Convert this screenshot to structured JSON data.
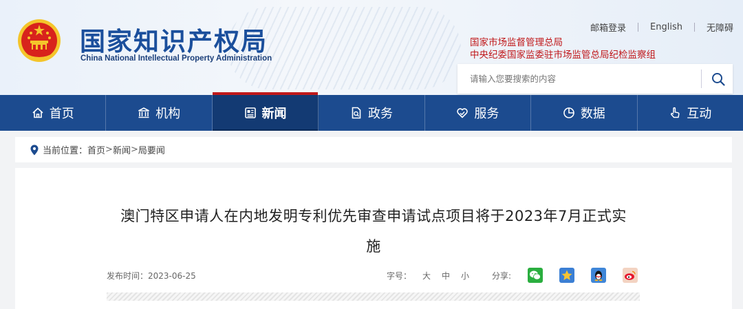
{
  "header": {
    "logo_cn": "国家知识产权局",
    "logo_en": "China National Intellectual Property Administration",
    "top_links": [
      "邮箱登录",
      "English",
      "无障碍"
    ],
    "agencies": [
      "国家市场监督管理总局",
      "中央纪委国家监委驻市场监管总局纪检监察组"
    ],
    "search_placeholder": "请输入您要搜索的内容"
  },
  "nav": {
    "items": [
      {
        "label": "首页",
        "icon": "home-icon"
      },
      {
        "label": "机构",
        "icon": "institution-icon"
      },
      {
        "label": "新闻",
        "icon": "news-icon",
        "active": true
      },
      {
        "label": "政务",
        "icon": "document-icon"
      },
      {
        "label": "服务",
        "icon": "service-heart-icon"
      },
      {
        "label": "数据",
        "icon": "pie-chart-icon"
      },
      {
        "label": "互动",
        "icon": "hand-pointer-icon"
      }
    ]
  },
  "breadcrumb": {
    "prefix": "当前位置：",
    "items": [
      "首页",
      "新闻",
      "局要闻"
    ],
    "separator": ">"
  },
  "article": {
    "title_line1": "澳门特区申请人在内地发明专利优先审查申请试点项目将于2023年7月正式实",
    "title_line2": "施",
    "publish_label": "发布时间：",
    "publish_date": "2023-06-25",
    "fontsize_label": "字号：",
    "fontsizes": [
      "大",
      "中",
      "小"
    ],
    "share_label": "分享:",
    "share_icons": [
      "wechat-icon",
      "qzone-star-icon",
      "qq-penguin-icon",
      "weibo-icon"
    ]
  },
  "colors": {
    "nav_bg": "#1c4b8f",
    "nav_active": "#133a73",
    "brand_blue": "#1b4f9c",
    "agency_red": "#c0191b"
  }
}
